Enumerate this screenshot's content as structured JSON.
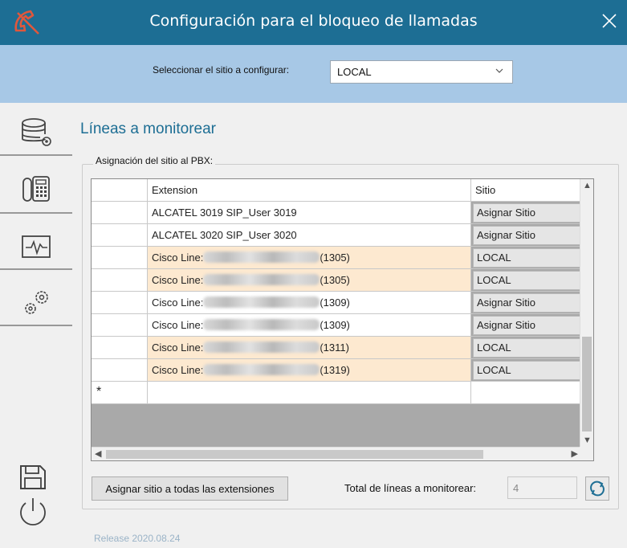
{
  "window": {
    "title": "Configuración para el bloqueo de llamadas"
  },
  "site_selector": {
    "label": "Seleccionar el sitio a configurar:",
    "value": "LOCAL"
  },
  "section": {
    "heading": "Líneas a monitorear",
    "group_label": "Asignación del sitio al PBX:"
  },
  "grid": {
    "columns": [
      "Extension",
      "Sitio"
    ],
    "rows": [
      {
        "extension": "ALCATEL 3019 SIP_User 3019",
        "sitio": "Asignar Sitio",
        "highlight": false
      },
      {
        "extension": "ALCATEL 3020 SIP_User 3020",
        "sitio": "Asignar Sitio",
        "highlight": false
      },
      {
        "ext_prefix": "Cisco Line:",
        "ext_suffix": "(1305)",
        "sitio": "LOCAL",
        "highlight": true
      },
      {
        "ext_prefix": "Cisco Line:",
        "ext_suffix": "(1305)",
        "sitio": "LOCAL",
        "highlight": true
      },
      {
        "ext_prefix": "Cisco Line:",
        "ext_suffix": "(1309)",
        "sitio": "Asignar Sitio",
        "highlight": false
      },
      {
        "ext_prefix": "Cisco Line:",
        "ext_suffix": "(1309)",
        "sitio": "Asignar Sitio",
        "highlight": false
      },
      {
        "ext_prefix": "Cisco Line:",
        "ext_suffix": "(1311)",
        "sitio": "LOCAL",
        "highlight": true
      },
      {
        "ext_prefix": "Cisco Line:",
        "ext_suffix": "(1319)",
        "sitio": "LOCAL",
        "highlight": true
      }
    ],
    "new_row_marker": "*"
  },
  "actions": {
    "assign_all": "Asignar sitio a todas las extensiones",
    "total_label": "Total de líneas a monitorear:",
    "total_value": "4"
  },
  "footer": {
    "release": "Release 2020.08.24"
  },
  "colors": {
    "titlebar": "#1d6e94",
    "sitebar": "#a7c8e6",
    "highlight_row": "#fde9d0",
    "heading": "#1d6e94"
  },
  "icons": {
    "app": "phone-cross-icon",
    "nav": [
      "database-settings-icon",
      "phone-keypad-icon",
      "pulse-monitor-icon",
      "gears-icon"
    ],
    "bottom": [
      "save-icon",
      "power-icon"
    ]
  }
}
